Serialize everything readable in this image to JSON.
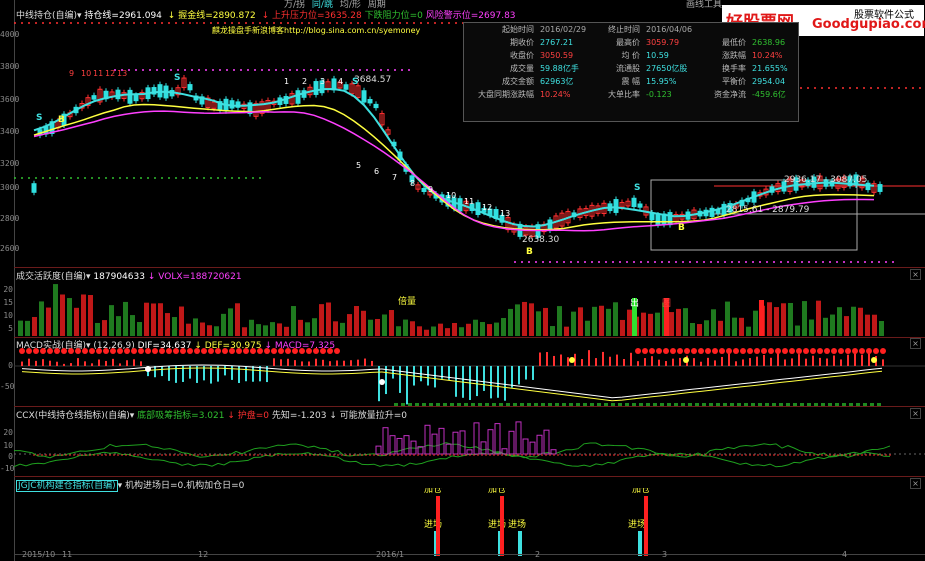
{
  "menu": {
    "items": [
      "万/拐",
      "同/跳",
      "均/形",
      "周期"
    ],
    "right_label": "画线工具"
  },
  "main": {
    "title": "中线持仓(自编)",
    "values": [
      {
        "label": "持仓线=2961.094",
        "color": "#ffffff"
      },
      {
        "label": "↓ 握金线=2890.872",
        "color": "#ffff40"
      },
      {
        "label": "↓ 上升压力位=3635.28",
        "color": "#ff3030"
      },
      {
        "label": "下跌阻力位=0",
        "color": "#30c030"
      },
      {
        "label": "风险警示位=2697.83",
        "color": "#ff40ff"
      }
    ],
    "blog": "麒龙操盘手新浪博客http://blog.sina.com.cn/syemoney",
    "price_labels": [
      "3684.57",
      "2638.30",
      "2936.17",
      "3087.05",
      "2815.61",
      "2879.79"
    ],
    "counts": [
      "9",
      "10",
      "11",
      "12",
      "13",
      "1",
      "2",
      "3",
      "4",
      "5",
      "6",
      "7",
      "8",
      "9",
      "10",
      "11",
      "12",
      "13"
    ],
    "yticks": [
      "4000",
      "3800",
      "3600",
      "3400",
      "3200",
      "3000",
      "2800",
      "2600"
    ]
  },
  "infobox": {
    "rows": [
      [
        {
          "l": "起始时间",
          "v": "2016/02/29"
        },
        {
          "l": "终止时间",
          "v": "2016/04/06"
        },
        {
          "l": "",
          "v": ""
        }
      ],
      [
        {
          "l": "期收价",
          "v": "2767.21",
          "c": "cyan"
        },
        {
          "l": "最高价",
          "v": "3059.79",
          "c": "red"
        },
        {
          "l": "最低价",
          "v": "2638.96",
          "c": "grn"
        }
      ],
      [
        {
          "l": "收盘价",
          "v": "3050.59",
          "c": "red"
        },
        {
          "l": "均 价",
          "v": "10.59",
          "c": "cyan"
        },
        {
          "l": "涨跌幅",
          "v": "10.24%",
          "c": "red"
        }
      ],
      [
        {
          "l": "成交量",
          "v": "59.88亿手",
          "c": "cyan"
        },
        {
          "l": "流通股",
          "v": "27650亿股",
          "c": "cyan"
        },
        {
          "l": "换手率",
          "v": "21.655%",
          "c": "cyan"
        }
      ],
      [
        {
          "l": "成交金额",
          "v": "62963亿",
          "c": "cyan"
        },
        {
          "l": "震 幅",
          "v": "15.95%",
          "c": "cyan"
        },
        {
          "l": "平衡价",
          "v": "2954.04",
          "c": "cyan"
        }
      ],
      [
        {
          "l": "大盘同期涨跌幅",
          "v": "10.24%",
          "c": "red"
        },
        {
          "l": "大单比率",
          "v": "-0.123",
          "c": "grn"
        },
        {
          "l": "资金净流",
          "v": "-459.6亿",
          "c": "grn"
        }
      ]
    ]
  },
  "watermark": {
    "main": "好股票网",
    "domain": "Goodgupiao.com",
    "sub": "股票软件公式"
  },
  "vol": {
    "title": "成交活跃度(自编)",
    "values": [
      {
        "label": "187904633",
        "color": "#ffffff"
      },
      {
        "label": "↓ VOLX=188720621",
        "color": "#ff40ff"
      }
    ],
    "tags": [
      "倍量",
      "出",
      "图"
    ],
    "yticks": [
      "20",
      "15",
      "10",
      "5"
    ]
  },
  "macd": {
    "title": "MACD实战(自编)",
    "values": [
      {
        "label": "(12,26,9)",
        "color": "#dddddd"
      },
      {
        "label": "DIF=34.637",
        "color": "#ffffff"
      },
      {
        "label": "↓ DEF=30.975",
        "color": "#ffff40"
      },
      {
        "label": "↓ MACD=7.325",
        "color": "#ff40ff"
      }
    ],
    "yticks": [
      "0",
      "-50"
    ]
  },
  "ccx": {
    "title": "CCX(中线持仓线指标)(自编)",
    "values": [
      {
        "label": "底部吸筹指标=3.021",
        "color": "#30c030"
      },
      {
        "label": "↓ 护盘=0",
        "color": "#ff3030"
      },
      {
        "label": "先知=-1.203",
        "color": "#dddddd"
      },
      {
        "label": "↓ 可能放量拉升=0",
        "color": "#dddddd"
      }
    ],
    "yticks": [
      "20",
      "10",
      "0",
      "-10"
    ]
  },
  "jgjc": {
    "title": "JGJC机构建仓指标(自编)",
    "values": [
      {
        "label": "机构进场日=0.机构加仓日=0",
        "color": "#dddddd"
      }
    ],
    "signals": [
      {
        "enter": "进场",
        "add": "加仓"
      },
      {
        "enter": "进场",
        "add": "加仓"
      },
      {
        "enter": "进场",
        "add": ""
      },
      {
        "enter": "进场",
        "add": "加仓"
      }
    ]
  },
  "xaxis": [
    "2015/10",
    "11",
    "12",
    "2016/1",
    "2",
    "3",
    "4"
  ],
  "colors": {
    "up": "#ff3030",
    "down": "#30e0e0",
    "cyan": "#3fe0e0",
    "magenta": "#ff40ff",
    "yellow": "#ffff40",
    "green": "#30c030"
  }
}
